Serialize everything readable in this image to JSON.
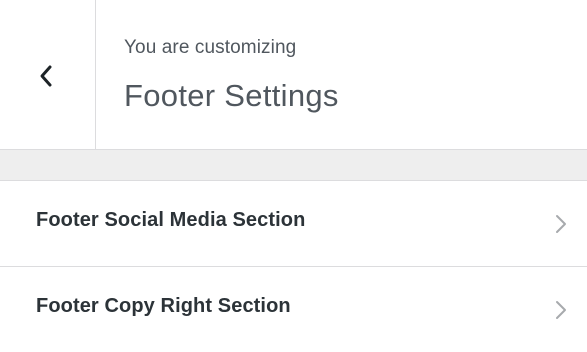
{
  "header": {
    "back_icon": "chevron-left-icon",
    "customizing_label": "You are customizing",
    "panel_title": "Footer Settings"
  },
  "sections": [
    {
      "label": "Footer Social Media Section",
      "icon": "chevron-right-icon"
    },
    {
      "label": "Footer Copy Right Section",
      "icon": "chevron-right-icon"
    }
  ],
  "colors": {
    "border": "#dcdcde",
    "spacer_bg": "#eeeeee",
    "text_primary": "#2c3338",
    "text_secondary": "#50575e",
    "chevron": "#a7aaad"
  }
}
